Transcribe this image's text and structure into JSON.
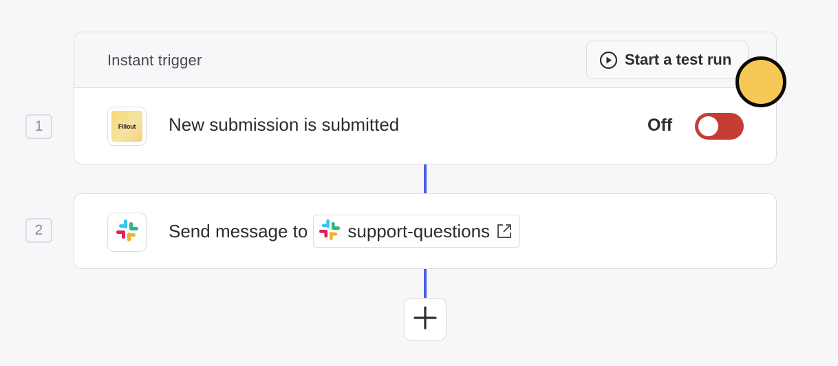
{
  "trigger": {
    "header_title": "Instant trigger",
    "test_run_label": "Start a test run",
    "step_number": "1",
    "app_logo_text": "Fillout",
    "step_text": "New submission is submitted",
    "toggle_label": "Off",
    "toggle_on": false,
    "toggle_color": "#c43d33"
  },
  "action": {
    "step_number": "2",
    "app": "slack",
    "step_text": "Send message to",
    "channel": "support-questions"
  },
  "connector_color": "#4b5ee8",
  "icons": {
    "play": "play-circle-icon",
    "external": "external-link-icon",
    "add": "plus-icon",
    "slack": "slack-logo-icon"
  },
  "cursor_color": "#f6c855"
}
